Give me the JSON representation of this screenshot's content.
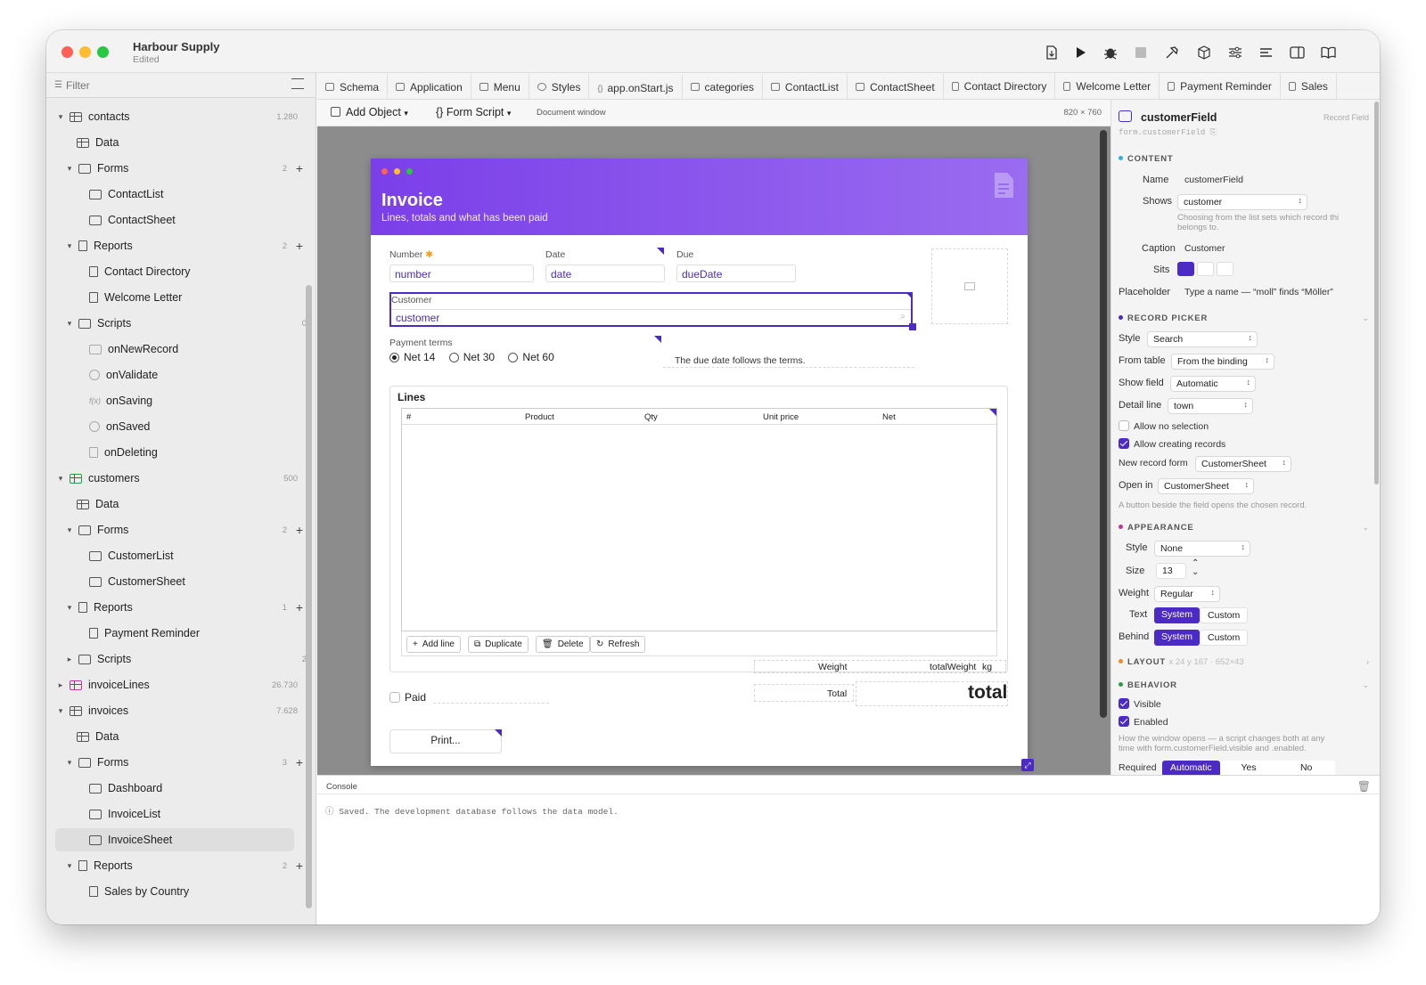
{
  "window": {
    "title": "Harbour Supply",
    "subtitle": "Edited"
  },
  "sidebar": {
    "filter_placeholder": "Filter",
    "items": [
      {
        "label": "contacts",
        "count": "1.280"
      },
      {
        "label": "Data"
      },
      {
        "label": "Forms",
        "count": "2"
      },
      {
        "label": "ContactList"
      },
      {
        "label": "ContactSheet"
      },
      {
        "label": "Reports",
        "count": "2"
      },
      {
        "label": "Contact Directory"
      },
      {
        "label": "Welcome Letter"
      },
      {
        "label": "Scripts",
        "count": "0"
      },
      {
        "label": "onNewRecord"
      },
      {
        "label": "onValidate"
      },
      {
        "label": "onSaving"
      },
      {
        "label": "onSaved"
      },
      {
        "label": "onDeleting"
      },
      {
        "label": "customers",
        "count": "500"
      },
      {
        "label": "Data"
      },
      {
        "label": "Forms",
        "count": "2"
      },
      {
        "label": "CustomerList"
      },
      {
        "label": "CustomerSheet"
      },
      {
        "label": "Reports",
        "count": "1"
      },
      {
        "label": "Payment Reminder"
      },
      {
        "label": "Scripts",
        "count": "2"
      },
      {
        "label": "invoiceLines",
        "count": "26.730"
      },
      {
        "label": "invoices",
        "count": "7.628"
      },
      {
        "label": "Data"
      },
      {
        "label": "Forms",
        "count": "3"
      },
      {
        "label": "Dashboard"
      },
      {
        "label": "InvoiceList"
      },
      {
        "label": "InvoiceSheet"
      },
      {
        "label": "Reports",
        "count": "2"
      },
      {
        "label": "Sales by Country"
      }
    ]
  },
  "tabs": [
    "Schema",
    "Application",
    "Menu",
    "Styles",
    "app.onStart.js",
    "categories",
    "ContactList",
    "ContactSheet",
    "Contact Directory",
    "Welcome Letter",
    "Payment Reminder",
    "Sales"
  ],
  "toolbar": {
    "add_object": "Add Object",
    "form_script": "{} Form Script",
    "doc_type": "Document window",
    "size": "820 × 760"
  },
  "form": {
    "title": "Invoice",
    "subtitle": "Lines, totals and what has been paid",
    "number_label": "Number",
    "number_value": "number",
    "date_label": "Date",
    "date_value": "date",
    "due_label": "Due",
    "due_value": "dueDate",
    "customer_label": "Customer",
    "customer_value": "customer",
    "terms_label": "Payment terms",
    "terms": [
      "Net 14",
      "Net 30",
      "Net 60"
    ],
    "terms_note": "The due date follows the terms.",
    "lines_title": "Lines",
    "columns": [
      "#",
      "Product",
      "Qty",
      "Unit price",
      "Net"
    ],
    "add_line": "Add line",
    "duplicate": "Duplicate",
    "delete": "Delete",
    "refresh": "Refresh",
    "weight_label": "Weight",
    "weight_value": "totalWeight",
    "weight_unit": "kg",
    "paid_label": "Paid",
    "total_label": "Total",
    "total_value": "total",
    "print_label": "Print..."
  },
  "console": {
    "title": "Console",
    "message": "Saved. The development database follows the data model."
  },
  "inspector": {
    "name": "customerField",
    "kind": "Record Field",
    "path": "form.customerField",
    "content_title": "CONTENT",
    "name_label": "Name",
    "name_value": "customerField",
    "shows_label": "Shows",
    "shows_value": "customer",
    "shows_note1": "Choosing from the list sets which record thi",
    "shows_note2": "belongs to.",
    "caption_label": "Caption",
    "caption_value": "Customer",
    "sits_label": "Sits",
    "placeholder_label": "Placeholder",
    "placeholder_value": "Type a name — “moll” finds “Möller”",
    "picker_title": "RECORD PICKER",
    "style_label": "Style",
    "style_value": "Search",
    "from_label": "From table",
    "from_value": "From the binding",
    "show_label": "Show field",
    "show_value": "Automatic",
    "detail_label": "Detail line",
    "detail_value": "town",
    "allow_none": "Allow no selection",
    "allow_create": "Allow creating records",
    "newform_label": "New record form",
    "newform_value": "CustomerSheet",
    "openin_label": "Open in",
    "openin_value": "CustomerSheet",
    "picker_note": "A button beside the field opens the chosen record.",
    "appearance_title": "APPEARANCE",
    "astyle_label": "Style",
    "astyle_value": "None",
    "size_label": "Size",
    "size_value": "13",
    "weight_label": "Weight",
    "weight_value": "Regular",
    "text_label": "Text",
    "behind_label": "Behind",
    "system": "System",
    "custom": "Custom",
    "layout_title": "LAYOUT",
    "layout_value": "x 24 y 167 · 652×43",
    "behavior_title": "BEHAVIOR",
    "visible": "Visible",
    "enabled": "Enabled",
    "behavior_note1": "How the window opens — a script changes both at any",
    "behavior_note2": "time with form.customerField.visible and .enabled.",
    "required_label": "Required",
    "req_auto": "Automatic",
    "req_yes": "Yes",
    "req_no": "No"
  },
  "colors": {
    "accent": "#4b2bc4",
    "header_start": "#7b3fe8",
    "header_end": "#9a6cf0"
  }
}
